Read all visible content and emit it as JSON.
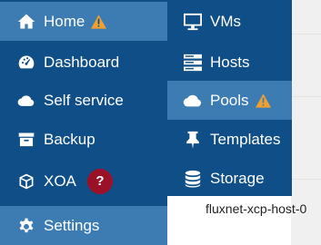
{
  "colors": {
    "sidebar_bg": "#0f4e86",
    "active_bg": "#3d7cb3",
    "warning": "#f0a030",
    "help_badge": "#9b1127"
  },
  "sidebar": {
    "items": [
      {
        "label": "Home",
        "icon": "home-icon",
        "active": true,
        "warning": true
      },
      {
        "label": "Dashboard",
        "icon": "dashboard-icon"
      },
      {
        "label": "Self service",
        "icon": "cloud-icon"
      },
      {
        "label": "Backup",
        "icon": "archive-icon"
      },
      {
        "label": "XOA",
        "icon": "cube-icon",
        "badge": "?"
      },
      {
        "label": "Settings",
        "icon": "gear-icon",
        "active": true
      }
    ]
  },
  "submenu": {
    "items": [
      {
        "label": "VMs",
        "icon": "desktop-icon"
      },
      {
        "label": "Hosts",
        "icon": "server-icon"
      },
      {
        "label": "Pools",
        "icon": "cloud-icon",
        "active": true,
        "warning": true
      },
      {
        "label": "Templates",
        "icon": "thumbtack-icon"
      },
      {
        "label": "Storage",
        "icon": "database-icon"
      }
    ]
  },
  "background": {
    "host_name": "fluxnet-xcp-host-0"
  }
}
